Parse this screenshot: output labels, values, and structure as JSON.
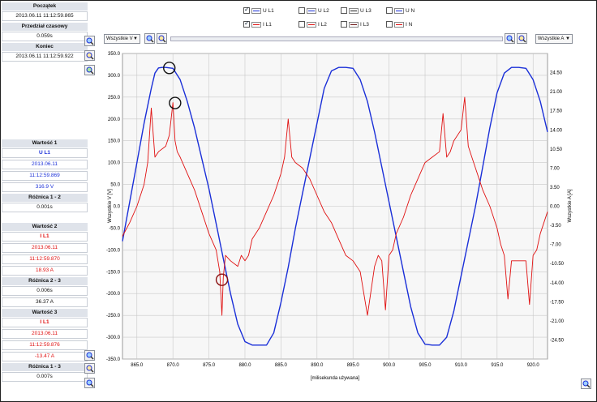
{
  "left_panel": {
    "start_label": "Początek",
    "start_value": "2013.06.11 11:12:59.865",
    "interval_label": "Przedział czasowy",
    "interval_value": "0.059s",
    "end_label": "Koniec",
    "end_value": "2013.06.11 11:12:59.922",
    "value1": {
      "label": "Wartość 1",
      "channel": "U L1",
      "date": "2013.06.11",
      "time": "11:12:59.869",
      "value": "316.9 V"
    },
    "diff12": {
      "label": "Różnica 1 - 2",
      "value": "0.001s"
    },
    "value2": {
      "label": "Wartość 2",
      "channel": "I L1",
      "date": "2013.06.11",
      "time": "11:12:59.870",
      "value": "18.93 A"
    },
    "diff23": {
      "label": "Różnica 2 - 3",
      "value1": "0.006s",
      "value2": "36.37 A"
    },
    "value3": {
      "label": "Wartość 3",
      "channel": "I L1",
      "date": "2013.06.11",
      "time": "11:12:59.876",
      "value": "-13.47 A"
    },
    "diff13": {
      "label": "Różnica 1 - 3",
      "value": "0.007s"
    }
  },
  "legend": [
    {
      "name": "U L1",
      "checked": true,
      "color": "#1a2fd8"
    },
    {
      "name": "U L2",
      "checked": false,
      "color": "#1a2fd8"
    },
    {
      "name": "U L3",
      "checked": false,
      "color": "#222222"
    },
    {
      "name": "U N",
      "checked": false,
      "color": "#1a2fd8"
    },
    {
      "name": "I L1",
      "checked": true,
      "color": "#e01010"
    },
    {
      "name": "I L2",
      "checked": false,
      "color": "#e01010"
    },
    {
      "name": "I L3",
      "checked": false,
      "color": "#6b1010"
    },
    {
      "name": "I N",
      "checked": false,
      "color": "#e01010"
    }
  ],
  "toolbar": {
    "left_select": "Wszystkie V",
    "right_select": "Wszystkie A"
  },
  "chart_data": {
    "type": "line",
    "xlabel": "[milisekunda używana]",
    "ylabel_left": "Wszystkie V [V]",
    "ylabel_right": "Wszystkie A [A]",
    "xlim": [
      863,
      922
    ],
    "ylim_left": [
      -350,
      350
    ],
    "ylim_right": [
      -28,
      28
    ],
    "x_ticks": [
      "865.0",
      "870.0",
      "875.0",
      "880.0",
      "885.0",
      "890.0",
      "895.0",
      "900.0",
      "905.0",
      "910.0",
      "915.0",
      "920.0"
    ],
    "x_tick_values": [
      865,
      870,
      875,
      880,
      885,
      890,
      895,
      900,
      905,
      910,
      915,
      920
    ],
    "y_left_ticks": [
      "350.0",
      "300.0",
      "250.0",
      "200.0",
      "150.0",
      "100.0",
      "50.0",
      "0.0",
      "-50.0",
      "-100.0",
      "-150.0",
      "-200.0",
      "-250.0",
      "-300.0",
      "-350.0"
    ],
    "y_left_values": [
      350,
      300,
      250,
      200,
      150,
      100,
      50,
      0,
      -50,
      -100,
      -150,
      -200,
      -250,
      -300,
      -350
    ],
    "y_right_ticks": [
      "24.50",
      "21.00",
      "17.50",
      "14.00",
      "10.50",
      "7.00",
      "3.50",
      "0.00",
      "-3.50",
      "-7.00",
      "-10.50",
      "-14.00",
      "-17.50",
      "-21.00",
      "-24.50"
    ],
    "y_right_values": [
      24.5,
      21,
      17.5,
      14,
      10.5,
      7,
      3.5,
      0,
      -3.5,
      -7,
      -10.5,
      -14,
      -17.5,
      -21,
      -24.5
    ],
    "grid": true,
    "series": [
      {
        "name": "U L1",
        "axis": "left",
        "color": "#1a2fd8",
        "x": [
          863,
          864,
          865,
          866,
          867,
          867.5,
          868,
          868.5,
          869,
          870,
          871,
          872,
          873,
          874,
          875,
          876,
          877,
          878,
          879,
          880,
          881,
          882,
          883,
          884,
          885,
          886,
          887,
          888,
          889,
          890,
          891,
          892,
          893,
          894,
          895,
          896,
          897,
          898,
          899,
          900,
          901,
          902,
          903,
          904,
          905,
          906,
          907,
          908,
          909,
          910,
          911,
          912,
          913,
          914,
          915,
          916,
          917,
          918,
          919,
          920,
          921,
          922
        ],
        "y": [
          -80,
          10,
          100,
          190,
          270,
          305,
          317,
          318,
          318,
          316,
          290,
          240,
          180,
          110,
          40,
          -40,
          -120,
          -200,
          -270,
          -310,
          -318,
          -318,
          -318,
          -290,
          -220,
          -140,
          -50,
          30,
          110,
          190,
          270,
          310,
          318,
          318,
          316,
          290,
          240,
          170,
          90,
          10,
          -70,
          -150,
          -230,
          -290,
          -316,
          -318,
          -318,
          -300,
          -240,
          -160,
          -80,
          0,
          90,
          180,
          260,
          305,
          318,
          318,
          316,
          290,
          240,
          170
        ]
      },
      {
        "name": "I L1",
        "axis": "right",
        "color": "#e01010",
        "x": [
          863,
          864,
          865,
          866,
          866.5,
          867,
          867.5,
          868,
          869,
          869.5,
          870,
          870.3,
          870.6,
          871,
          872,
          873,
          874,
          875,
          876,
          876.5,
          876.8,
          877,
          877.3,
          878,
          879,
          879.5,
          880,
          880.5,
          881,
          882,
          883,
          884,
          885,
          885.5,
          886,
          886.5,
          887,
          888,
          889,
          890,
          891,
          892,
          893,
          894,
          895,
          896,
          897,
          898,
          898.5,
          899,
          899.5,
          900,
          900.5,
          901,
          902,
          903,
          904,
          905,
          906,
          907,
          907.5,
          908,
          908.5,
          909,
          910,
          910.5,
          911,
          911.5,
          912,
          913,
          914,
          915,
          915.5,
          916,
          916.5,
          917,
          918,
          919,
          919.5,
          920,
          920.5,
          921,
          922
        ],
        "y": [
          -5.5,
          -3,
          0,
          4,
          8,
          18,
          9,
          10,
          11,
          13,
          19,
          12,
          10,
          9,
          6,
          3,
          -1,
          -5,
          -8,
          -12,
          -20,
          -13,
          -9,
          -10,
          -11,
          -9,
          -10,
          -9,
          -6,
          -4,
          -1,
          2,
          6,
          9,
          16,
          9,
          8,
          7,
          5,
          2,
          -1,
          -3,
          -6,
          -9,
          -10,
          -12,
          -20,
          -11,
          -9,
          -10,
          -19,
          -9,
          -8,
          -5,
          -2,
          2,
          5,
          8,
          9,
          10,
          17,
          9,
          10,
          12,
          14,
          20,
          11,
          9,
          7,
          3,
          0,
          -4,
          -7,
          -9,
          -17,
          -10,
          -10,
          -10,
          -18,
          -9,
          -8,
          -5,
          -1
        ]
      }
    ],
    "markers": [
      {
        "series": "U L1",
        "x": 869.5,
        "y": 316.9,
        "color": "#111111"
      },
      {
        "series": "I L1",
        "x": 870.3,
        "y": 18.93,
        "color": "#111111"
      },
      {
        "series": "I L1",
        "x": 876.8,
        "y": -13.47,
        "color": "#8a1010"
      }
    ]
  }
}
